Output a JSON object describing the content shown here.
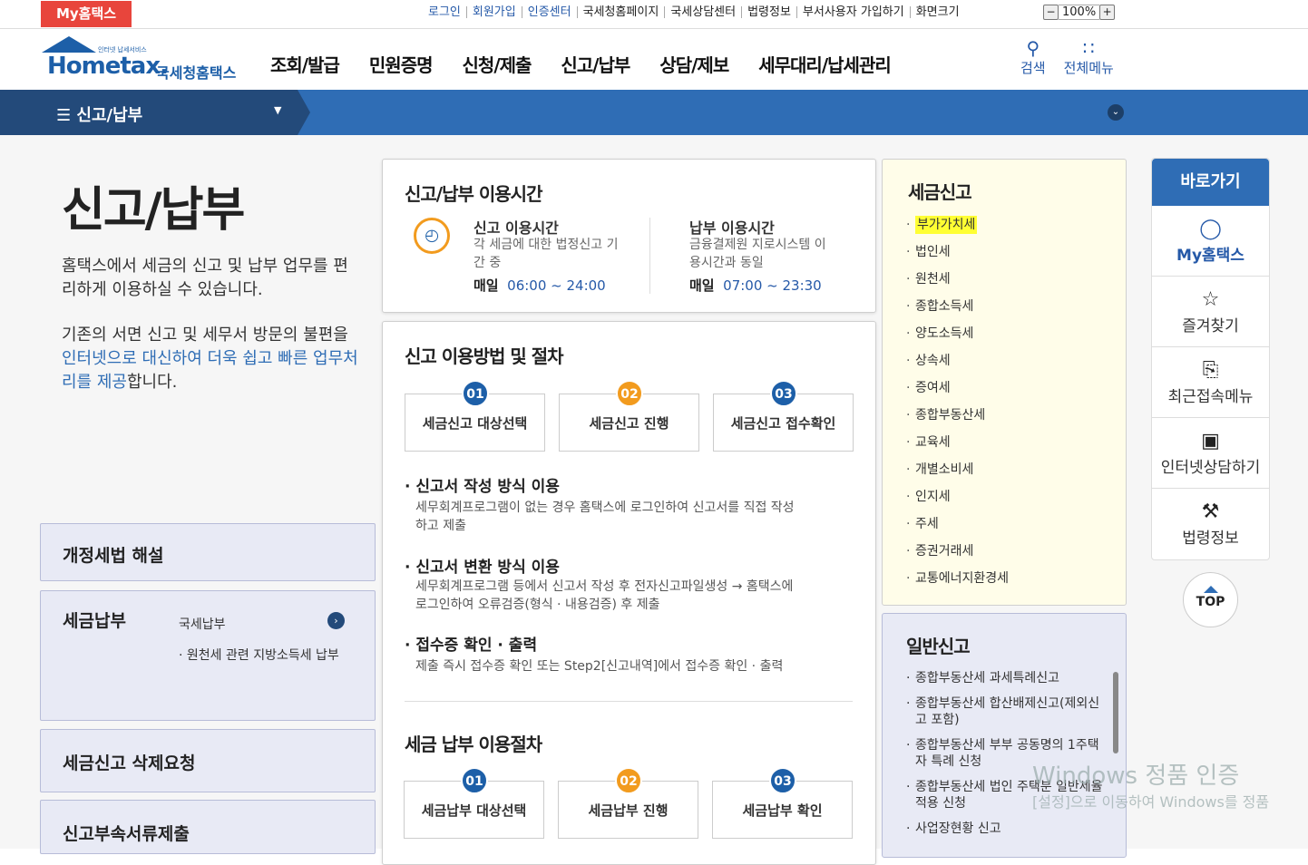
{
  "top": {
    "my_tab": "My홈택스",
    "links": [
      "로그인",
      "회원가입",
      "인증센터",
      "국세청홈페이지",
      "국세상담센터",
      "법령정보",
      "부서사용자 가입하기",
      "화면크기"
    ],
    "zoom_minus": "−",
    "zoom_value": "100%",
    "zoom_plus": "+"
  },
  "header": {
    "logo_sub": "인터넷 납세서비스",
    "logo_word": "Hometax.",
    "logo_kor": "국세청홈택스",
    "menu": [
      "조회/발급",
      "민원증명",
      "신청/제출",
      "신고/납부",
      "상담/제보",
      "세무대리/납세관리"
    ],
    "search_label": "검색",
    "allmenu_label": "전체메뉴"
  },
  "subnav": {
    "title": "신고/납부"
  },
  "left": {
    "title": "신고/납부",
    "desc1": "홈택스에서 세금의 신고 및 납부 업무를 편리하게 이용하실 수 있습니다.",
    "desc2_a": "기존의 서면 신고 및 세무서 방문의 불편을 ",
    "desc2_b": "인터넷으로 대신하여 더욱 쉽고 빠른 업무처리를 제공",
    "desc2_c": "합니다.",
    "box1": "개정세법 해설",
    "box2": "세금납부",
    "box2_items": [
      "국세납부",
      "원천세 관련 지방소득세 납부"
    ],
    "box3": "세금신고 삭제요청",
    "box4": "신고부속서류제출"
  },
  "hours": {
    "title": "신고/납부 이용시간",
    "report_title": "신고 이용시간",
    "report_desc": "각 세금에 대한 법정신고 기간 중",
    "report_daily": "매일",
    "report_time": "06:00 ~ 24:00",
    "pay_title": "납부 이용시간",
    "pay_desc": "금융결제원 지로시스템 이용시간과 동일",
    "pay_daily": "매일",
    "pay_time": "07:00 ~ 23:30"
  },
  "procedure": {
    "title": "신고 이용방법 및 절차",
    "steps": [
      {
        "num": "01",
        "label": "세금신고 대상선택"
      },
      {
        "num": "02",
        "label": "세금신고 진행"
      },
      {
        "num": "03",
        "label": "세금신고 접수확인"
      }
    ],
    "s1_title": "신고서 작성 방식 이용",
    "s1_desc": "세무회계프로그램이 없는 경우 홈택스에 로그인하여 신고서를 직접 작성하고 제출",
    "s2_title": "신고서 변환 방식 이용",
    "s2_desc": "세무회계프로그램 등에서 신고서 작성 후 전자신고파일생성 → 홈택스에 로그인하여 오류검증(형식 · 내용검증) 후 제출",
    "s3_title": "접수증 확인 · 출력",
    "s3_desc": "제출 즉시 접수증 확인 또는 Step2[신고내역]에서 접수증 확인 · 출력",
    "pay_title": "세금 납부 이용절차",
    "pay_steps": [
      {
        "num": "01",
        "label": "세금납부 대상선택"
      },
      {
        "num": "02",
        "label": "세금납부 진행"
      },
      {
        "num": "03",
        "label": "세금납부 확인"
      }
    ]
  },
  "tax_report": {
    "title": "세금신고",
    "items": [
      "부가가치세",
      "법인세",
      "원천세",
      "종합소득세",
      "양도소득세",
      "상속세",
      "증여세",
      "종합부동산세",
      "교육세",
      "개별소비세",
      "인지세",
      "주세",
      "증권거래세",
      "교통에너지환경세"
    ]
  },
  "general_report": {
    "title": "일반신고",
    "items": [
      "종합부동산세 과세특례신고",
      "종합부동산세 합산배제신고(제외신고 포함)",
      "종합부동산세 부부 공동명의 1주택자 특례 신청",
      "종합부동산세 법인 주택분 일반세율 적용 신청",
      "사업장현황 신고"
    ]
  },
  "quick": {
    "title": "바로가기",
    "items": [
      "My홈택스",
      "즐겨찾기",
      "최근접속메뉴",
      "인터넷상담하기",
      "법령정보"
    ],
    "top": "TOP"
  },
  "watermark": {
    "line1": "Windows 정품 인증",
    "line2": "[설정]으로 이동하여 Windows를 정품"
  },
  "colors": {
    "accent": "#2f6db5",
    "highlight": "#ffff33"
  }
}
